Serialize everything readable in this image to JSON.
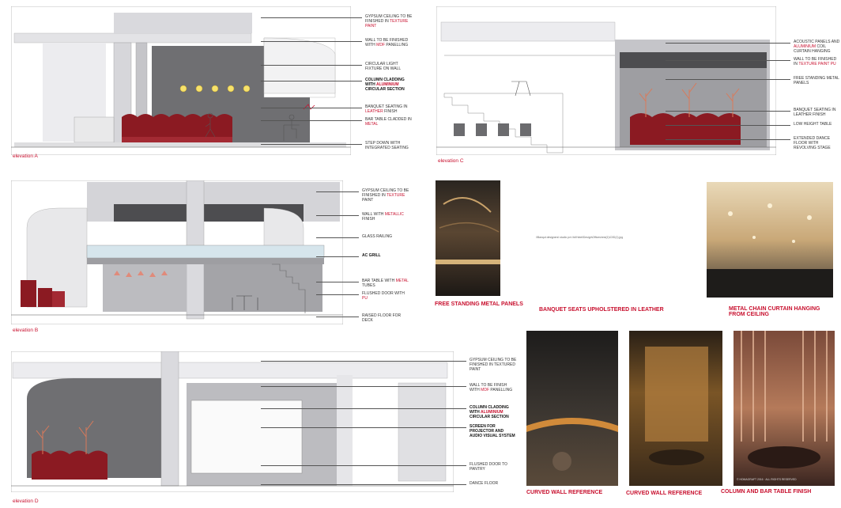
{
  "colors": {
    "accent_red": "#c8102e",
    "wall_grey": "#6f6f72",
    "light_grey": "#cfcfd3",
    "seat_maroon": "#8b1a22",
    "line": "#555555"
  },
  "elevations": {
    "a": {
      "label": "elevation A",
      "notes": [
        {
          "pre": "GYPSUM CEILING TO BE FINISHED IN ",
          "hl": "TEXTURE PAINT",
          "post": ""
        },
        {
          "pre": "WALL TO BE FINISHED WITH ",
          "hl": "MDF",
          "post": " PANELLING"
        },
        {
          "pre": "CIRCULAR LIGHT FIXTURE ON WALL",
          "hl": "",
          "post": ""
        },
        {
          "pre": "COLUMN CLADDING WITH ",
          "hl": "ALUMINIUM",
          "post": " CIRCULAR SECTION"
        },
        {
          "pre": "BANQUET SEATING IN ",
          "hl": "LEATHER",
          "post": " FINISH"
        },
        {
          "pre": "BAR TABLE CLADDED IN ",
          "hl": "METAL",
          "post": ""
        },
        {
          "pre": "STEP DOWN WITH INTEGRATED SEATING",
          "hl": "",
          "post": ""
        }
      ]
    },
    "b": {
      "label": "elevation B",
      "notes": [
        {
          "pre": "GYPSUM CEILING TO BE FINISHED IN ",
          "hl": "TEXTURE",
          "post": " PAINT"
        },
        {
          "pre": "WALL WITH ",
          "hl": "METALLIC",
          "post": " FINISH"
        },
        {
          "pre": "GLASS RAILING",
          "hl": "",
          "post": ""
        },
        {
          "pre": "AC GRILL",
          "hl": "",
          "post": ""
        },
        {
          "pre": "BAR TABLE WITH ",
          "hl": "METAL",
          "post": " TUBES"
        },
        {
          "pre": "FLUSHED DOOR WITH ",
          "hl": "PU",
          "post": ""
        },
        {
          "pre": "RAISED FLOOR FOR DECK",
          "hl": "",
          "post": ""
        }
      ]
    },
    "c": {
      "label": "elevation C",
      "notes": [
        {
          "pre": "ACOUSTIC PANELS AND ",
          "hl": "ALUMINIUM",
          "post": " COIL CURTAIN HANGING"
        },
        {
          "pre": "WALL TO BE FINISHED IN ",
          "hl": "TEXTURE PAINT PU",
          "post": ""
        },
        {
          "pre": "FREE STANDING METAL PANELS",
          "hl": "",
          "post": ""
        },
        {
          "pre": "BANQUET SEATING IN LEATHER FINISH",
          "hl": "",
          "post": ""
        },
        {
          "pre": "LOW HEIGHT TABLE",
          "hl": "",
          "post": ""
        },
        {
          "pre": "EXTENDED DANCE FLOOR WITH REVOLVING STAGE",
          "hl": "",
          "post": ""
        }
      ]
    },
    "d": {
      "label": "elevation D",
      "notes": [
        {
          "pre": "GYPSUM CEILING TO BE FINISHED IN TEXTURED PAINT",
          "hl": "",
          "post": ""
        },
        {
          "pre": "WALL TO BE FINISH WITH ",
          "hl": "MDF",
          "post": " PANELLING"
        },
        {
          "pre": "COLUMN CLADDING WITH ",
          "hl": "ALUMINIUM",
          "post": " CIRCULAR SECTION"
        },
        {
          "pre": "SCREEN FOR PROJECTOR AND AUDIO VISUAL SYSTEM",
          "hl": "",
          "post": ""
        },
        {
          "pre": "FLUSHED DOOR TO PANTRY",
          "hl": "",
          "post": ""
        },
        {
          "pre": "DANCE FLOOR",
          "hl": "",
          "post": ""
        }
      ]
    }
  },
  "references": {
    "free_standing": "FREE STANDING METAL PANELS",
    "banquet": "BANQUET SEATS UPHOLSTERED IN LEATHER",
    "banquet_url": "\\\\Banqut designers\\ studio pvt. ltd\\Hotel\\Design\\Offices\\rest(1)\\C0D(1).jpg",
    "chain_curtain": "METAL CHAIN CURTAIN HANGING FROM CEILING",
    "curved_wall_1": "CURVED WALL REFERENCE",
    "curved_wall_2": "CURVED WALL REFERENCE",
    "column_bar": "COLUMN AND BAR TABLE FINISH",
    "watermark": "© HOMAGRAFT 2016 · ALL RIGHTS RESERVED"
  }
}
